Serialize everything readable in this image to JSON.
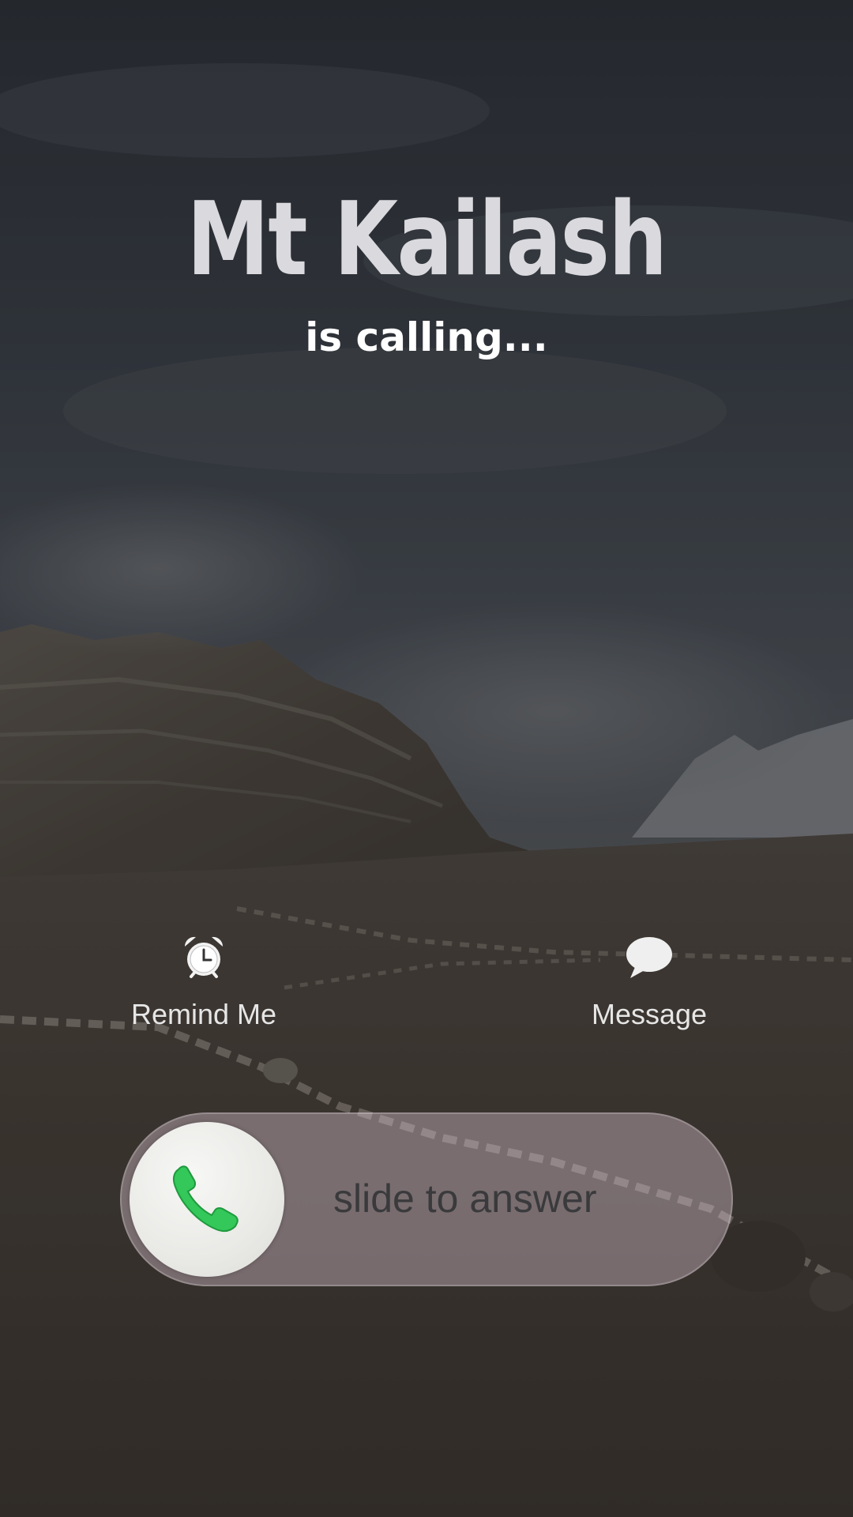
{
  "caller": {
    "name": "Mt Kailash",
    "status": "is calling..."
  },
  "actions": {
    "remind": {
      "label": "Remind Me",
      "icon": "alarm-clock-icon"
    },
    "message": {
      "label": "Message",
      "icon": "speech-bubble-icon"
    }
  },
  "slider": {
    "label": "slide to answer",
    "icon": "phone-icon",
    "accent": "#34c759"
  }
}
